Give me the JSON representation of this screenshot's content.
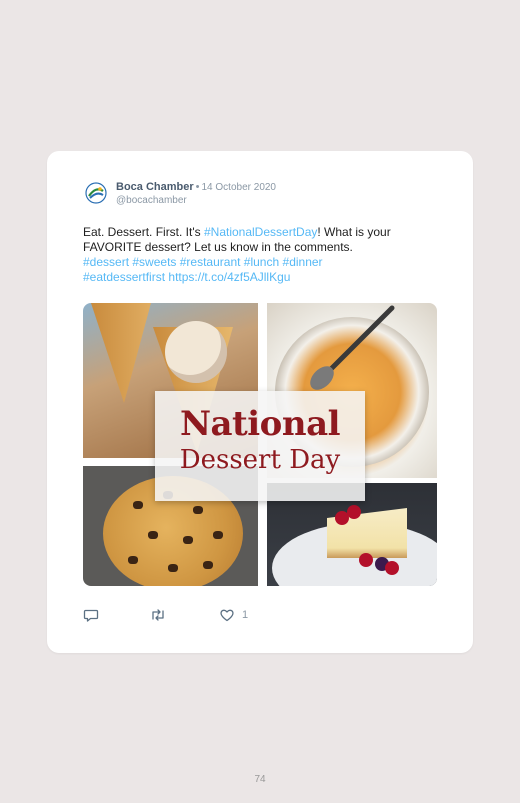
{
  "tweet": {
    "author_name": "Boca Chamber",
    "separator": "•",
    "date": "14 October 2020",
    "handle": "@bocachamber",
    "text_part1": "Eat. Dessert. First. It's ",
    "hashtag_main": "#NationalDessertDay",
    "text_part2": "! What is your FAVORITE dessert? Let us know in the comments.",
    "hashtags": [
      "#dessert",
      "#sweets",
      "#restaurant",
      "#lunch",
      "#dinner",
      "#eatdessertfirst"
    ],
    "url": "https://t.co/4zf5AJllKgu",
    "like_count": "1"
  },
  "image": {
    "banner_line1": "National",
    "banner_line2": "Dessert Day"
  },
  "icons": {
    "reply": "reply-icon",
    "retweet": "retweet-icon",
    "like": "heart-icon",
    "avatar": "boca-chamber-logo"
  },
  "colors": {
    "background": "#ebe6e6",
    "card": "#ffffff",
    "link": "#1da1f2",
    "banner_text": "#8e1a1f"
  },
  "page": {
    "number": "74"
  }
}
